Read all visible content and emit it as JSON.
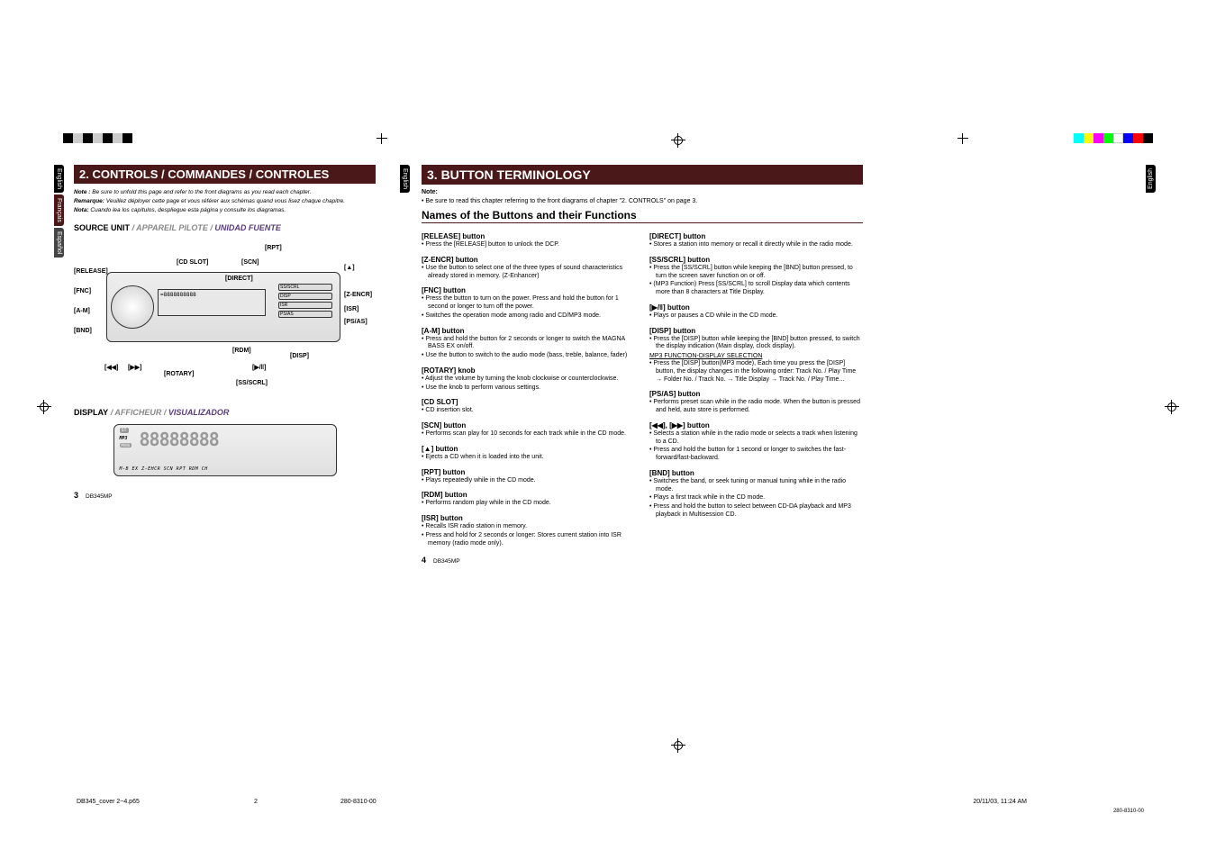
{
  "printmarks": {
    "timestamp": "20/11/03, 11:24 AM",
    "file": "DB345_cover 2~4.p65",
    "filepage": "2",
    "jobno": "280-8310-00"
  },
  "langs": {
    "en": "English",
    "fr": "Français",
    "es": "Español"
  },
  "left": {
    "title": "2.  CONTROLS / COMMANDES / CONTROLES",
    "note_en_b": "Note :",
    "note_en": " Be sure to unfold this page and refer to the front diagrams as you read each chapter.",
    "note_fr_b": "Remarque:",
    "note_fr": " Veuillez déployer cette page et vous référer aux schémas quand vous lisez chaque chapitre.",
    "note_es_b": "Nota:",
    "note_es": " Cuando lea los capítulos, despliegue esta página y consulte los diagramas.",
    "src_title_en": "SOURCE UNIT",
    "src_title_fr": " / APPAREIL PILOTE / ",
    "src_title_es": "UNIDAD FUENTE",
    "disp_title_en": "DISPLAY",
    "disp_title_fr": " / AFFICHEUR / ",
    "disp_title_es": "VISUALIZADOR",
    "labels": {
      "cd_slot": "[CD SLOT]",
      "rpt": "[RPT]",
      "scn": "[SCN]",
      "eject": "[▲]",
      "release": "[RELEASE]",
      "direct": "[DIRECT]",
      "fnc": "[FNC]",
      "zencr": "[Z-ENCR]",
      "am": "[A-M]",
      "isr": "[ISR]",
      "psas": "[PS/AS]",
      "bnd": "[BND]",
      "rdm": "[RDM]",
      "disp": "[DISP]",
      "prev": "[◀◀]",
      "next": "[▶▶]",
      "rotary": "[ROTARY]",
      "play": "[▶/‖]",
      "ssscrl": "[SS/SCRL]"
    },
    "lcd": {
      "seg": "88888888",
      "ind": "M-B EX Z-EHCR  SCN  RPT  RDM  CH",
      "st": "ST",
      "mp3": "MP3",
      "mb": "MANU"
    },
    "page": "3",
    "model": "DB345MP"
  },
  "right": {
    "title": "3. BUTTON TERMINOLOGY",
    "note_b": "Note:",
    "note": "• Be sure to read this chapter referring to the front diagrams of chapter \"2. CONTROLS\" on page 3.",
    "h2": "Names of the Buttons and their Functions",
    "col1": [
      {
        "h": "[RELEASE] button",
        "b": [
          "Press the [RELEASE] button to unlock the DCP."
        ]
      },
      {
        "h": "[Z-ENCR] button",
        "b": [
          "Use the button to select one of the three types of sound characteristics already stored in memory. (Z-Enhancer)"
        ]
      },
      {
        "h": "[FNC] button",
        "b": [
          "Press the button to turn on the power. Press and hold the button for 1 second or longer to turn off the power.",
          "Switches the operation mode among radio and CD/MP3 mode."
        ]
      },
      {
        "h": "[A-M] button",
        "b": [
          "Press and hold the button for 2 seconds or longer to switch the MAGNA BASS EX on/off.",
          "Use the button to switch to the audio mode (bass, treble, balance, fader)"
        ]
      },
      {
        "h": "[ROTARY] knob",
        "b": [
          "Adjust the volume by turning the knob clockwise or counterclockwise.",
          "Use the knob to perform various settings."
        ]
      },
      {
        "h": "[CD SLOT]",
        "b": [
          "CD insertion slot."
        ]
      },
      {
        "h": "[SCN] button",
        "b": [
          "Performs scan play for 10 seconds for each track while in the CD mode."
        ]
      },
      {
        "h": "[▲] button",
        "b": [
          "Ejects a CD when it is loaded into the unit."
        ]
      },
      {
        "h": "[RPT] button",
        "b": [
          "Plays repeatedly while in the CD mode."
        ]
      },
      {
        "h": "[RDM] button",
        "b": [
          "Performs random play while in the CD mode."
        ]
      },
      {
        "h": "[ISR] button",
        "b": [
          "Recalls ISR radio station in memory.",
          "Press and hold for 2 seconds or longer: Stores current station into ISR memory (radio mode only)."
        ]
      }
    ],
    "col2": [
      {
        "h": "[DIRECT] button",
        "b": [
          "Stores a station into memory or recall it directly while in the radio mode."
        ]
      },
      {
        "h": "[SS/SCRL] button",
        "b": [
          "Press the [SS/SCRL] button while keeping the [BND] button pressed, to turn the screen saver function on or off.",
          "(MP3 Function) Press [SS/SCRL] to scroll Display data which contents more than 8 characters at Title Display."
        ]
      },
      {
        "h": "[▶/‖] button",
        "b": [
          "Plays or pauses a CD while in the CD mode."
        ]
      },
      {
        "h": "[DISP] button",
        "b": [
          "Press the [DISP] button while keeping the [BND] button pressed, to switch the display indication (Main display, clock display)."
        ],
        "u": "MP3 FUNCTION-DISPLAY SELECTION",
        "b2": [
          "Press the [DISP] button(MP3 mode), Each time you press the [DISP] button, the display changes in the following order: Track No. / Play Time → Folder No. / Track No. → Title Display → Track No. / Play Time..."
        ]
      },
      {
        "h": "[PS/AS] button",
        "b": [
          "Performs preset scan while in the radio mode. When the button is pressed and held, auto store is performed."
        ]
      },
      {
        "h": "[◀◀], [▶▶] button",
        "b": [
          "Selects a station while in the radio mode or selects a track when listening to a CD.",
          "Press and hold the button for 1 second or longer to switches the fast-forward/fast-backward."
        ]
      },
      {
        "h": "[BND] button",
        "b": [
          "Switches the band, or seek tuning or manual tuning while in the radio mode.",
          "Plays a first track while in the CD mode.",
          "Press and hold the button to select between CD-DA playback and MP3 playback in Multisession CD."
        ]
      }
    ],
    "page": "4",
    "model": "DB345MP"
  }
}
